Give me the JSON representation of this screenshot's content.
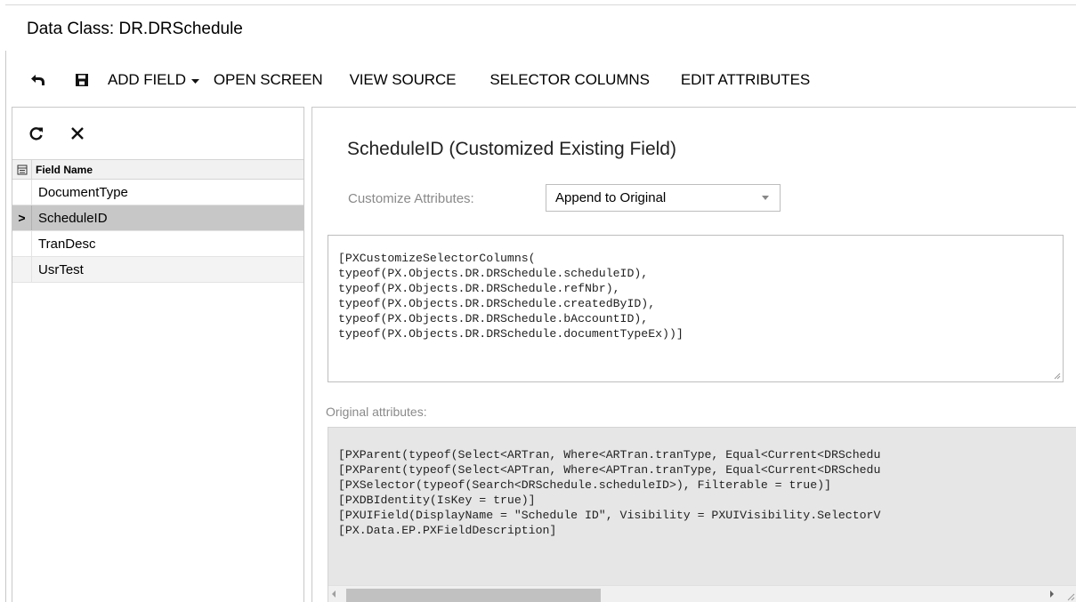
{
  "page": {
    "title": "Data Class: DR.DRSchedule"
  },
  "toolbar": {
    "undo_icon": "undo-icon",
    "save_icon": "save-icon",
    "add_field": "ADD FIELD",
    "open_screen": "OPEN SCREEN",
    "view_source": "VIEW SOURCE",
    "selector_columns": "SELECTOR COLUMNS",
    "edit_attributes": "EDIT ATTRIBUTES"
  },
  "grid": {
    "refresh_icon": "refresh-icon",
    "delete_icon": "close-icon",
    "header": "Field Name",
    "rows": [
      {
        "name": "DocumentType",
        "selected": false
      },
      {
        "name": "ScheduleID",
        "selected": true,
        "marker": ">"
      },
      {
        "name": "TranDesc",
        "selected": false
      },
      {
        "name": "UsrTest",
        "selected": false
      }
    ]
  },
  "detail": {
    "title": "ScheduleID (Customized Existing Field)",
    "customize_label": "Customize Attributes:",
    "customize_value": "Append to Original",
    "custom_attributes": [
      "[PXCustomizeSelectorColumns(",
      "typeof(PX.Objects.DR.DRSchedule.scheduleID),",
      "typeof(PX.Objects.DR.DRSchedule.refNbr),",
      "typeof(PX.Objects.DR.DRSchedule.createdByID),",
      "typeof(PX.Objects.DR.DRSchedule.bAccountID),",
      "typeof(PX.Objects.DR.DRSchedule.documentTypeEx))]"
    ],
    "original_label": "Original attributes:",
    "original_attributes": [
      "[PXParent(typeof(Select<ARTran, Where<ARTran.tranType, Equal<Current<DRSchedu",
      "[PXParent(typeof(Select<APTran, Where<APTran.tranType, Equal<Current<DRSchedu",
      "[PXSelector(typeof(Search<DRSchedule.scheduleID>), Filterable = true)]",
      "[PXDBIdentity(IsKey = true)]",
      "[PXUIField(DisplayName = \"Schedule ID\", Visibility = PXUIVisibility.SelectorV",
      "[PX.Data.EP.PXFieldDescription]"
    ]
  },
  "colors": {
    "selected_row": "#c7c7c7",
    "code_background": "#e6e6e6"
  }
}
